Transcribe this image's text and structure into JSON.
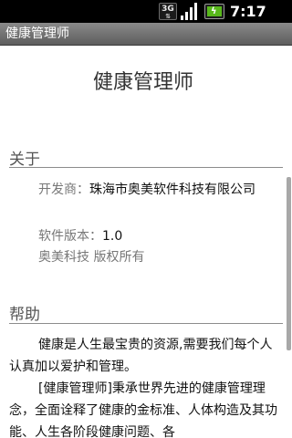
{
  "status_bar": {
    "network": "3G",
    "network_arrows": "⇅",
    "time": "7:17 AM",
    "icons": [
      "3g-icon",
      "signal-icon",
      "battery-charging-icon"
    ]
  },
  "title_bar": {
    "title": "健康管理师"
  },
  "about": {
    "app_name": "健康管理师",
    "header": "关于",
    "developer_label": "开发商：",
    "developer_value": "珠海市奥美软件科技有限公司",
    "version_label": "软件版本：",
    "version_value": "1.0",
    "copyright": "奥美科技 版权所有"
  },
  "help": {
    "header": "帮助",
    "paragraph1": "健康是人生最宝贵的资源,需要我们每个人认真加以爱护和管理。",
    "paragraph2": "[健康管理师]秉承世界先进的健康管理理念，全面诠释了健康的金标准、人体构造及其功能、人生各阶段健康问题、各"
  },
  "colors": {
    "status_bar_bg": "#000000",
    "title_bar_bg": "#6e6e6e",
    "battery_fill": "#58b81b",
    "label_gray": "#777777",
    "text": "#111111"
  }
}
